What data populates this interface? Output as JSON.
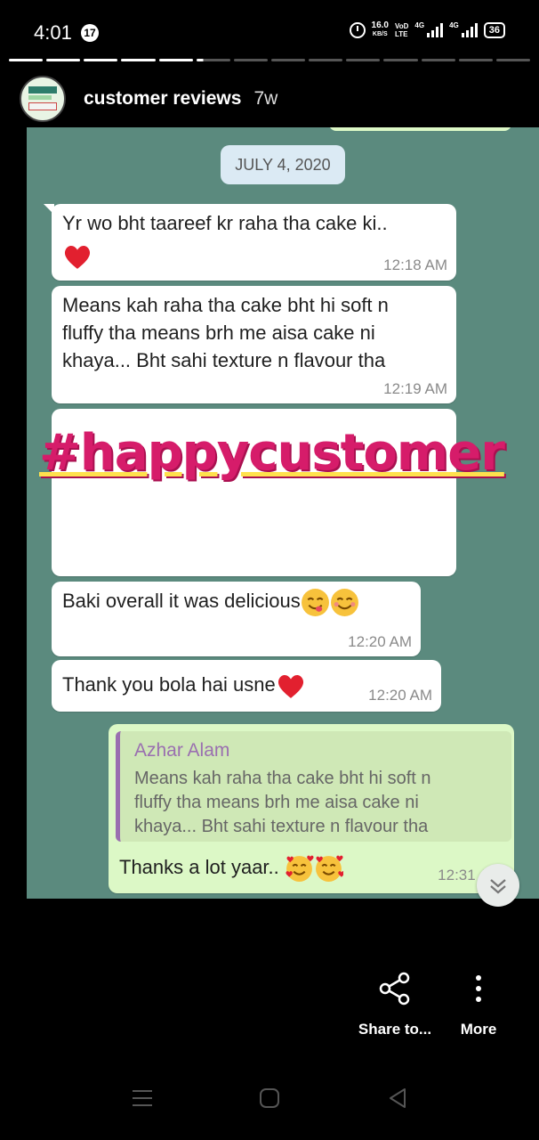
{
  "status_bar": {
    "time": "4:01",
    "notification_count": "17",
    "net_speed_value": "16.0",
    "net_speed_unit": "KB/S",
    "volte_top": "VoD",
    "volte_bottom": "LTE",
    "signal1_label": "4G",
    "signal2_label": "4G",
    "battery": "36"
  },
  "story": {
    "segments_total": 14,
    "segments_done": 5,
    "username": "customer reviews",
    "age": "7w"
  },
  "chat": {
    "date": "JULY 4, 2020",
    "messages": [
      {
        "text": "Yr wo bht taareef kr raha tha cake ki..",
        "time": "12:18 AM"
      },
      {
        "text_lines": [
          "Means kah raha tha cake bht hi soft n",
          "fluffy tha means brh me aisa cake ni",
          "khaya... Bht sahi texture n flavour tha"
        ],
        "time": "12:19 AM"
      },
      {
        "text": "Baki overall it was delicious",
        "time": "12:20 AM"
      },
      {
        "text": "Thank you bola hai usne",
        "time": "12:20 AM"
      }
    ],
    "reply": {
      "quoted_name": "Azhar Alam",
      "quoted_lines": [
        "Means kah raha tha cake bht hi soft n",
        "fluffy tha means brh me aisa cake ni",
        "khaya... Bht sahi texture n flavour tha"
      ],
      "text": "Thanks a lot yaar..",
      "time": "12:31 AM"
    },
    "sticker_text": "#happycustomer"
  },
  "actions": {
    "share_label": "Share to...",
    "more_label": "More"
  },
  "colors": {
    "chat_background": "#5b8a7e",
    "outgoing_bubble": "#dcf8c6",
    "hashtag": "#d61c6a",
    "quote_name": "#9a6fb0"
  }
}
